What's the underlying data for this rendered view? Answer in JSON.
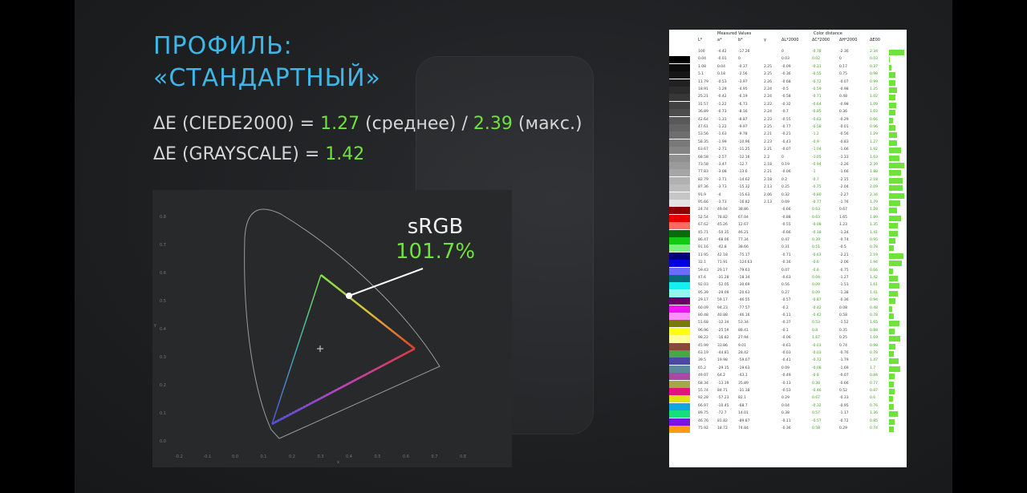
{
  "title": {
    "line1": "ПРОФИЛЬ:",
    "line2": "«СТАНДАРТНЫЙ»"
  },
  "metrics": {
    "m1_prefix": "ΔE (CIEDE2000) = ",
    "m1_avg": "1.27",
    "m1_avg_label": " (среднее) / ",
    "m1_max": "2.39",
    "m1_max_label": " (макс.)",
    "m2_prefix": "ΔE (GRAYSCALE) = ",
    "m2_value": "1.42"
  },
  "gamut": {
    "label": "sRGB",
    "percent": "101.7%",
    "accent": "#6fe33c"
  },
  "chart_axes": {
    "x_ticks": [
      "-0.2",
      "-0.1",
      "0.0",
      "0.1",
      "0.2",
      "0.3",
      "0.4",
      "0.5",
      "0.6",
      "0.7",
      "0.8"
    ],
    "y_ticks": [
      "0.0",
      "0.1",
      "0.2",
      "0.3",
      "0.4",
      "0.5",
      "0.6",
      "0.7",
      "0.8"
    ],
    "x_label": "x",
    "y_label": "y"
  },
  "table": {
    "header_measured": "Measured Values",
    "header_distance": "Color distance",
    "columns": [
      "L*",
      "a*",
      "b*",
      "γ",
      "ΔL*2000",
      "ΔC*2000",
      "ΔH*2000",
      "ΔE00"
    ],
    "rows": [
      {
        "color": "#ffffff",
        "L": "100",
        "a": "-4.42",
        "b": "-17.26",
        "g": "",
        "dL": "0",
        "dC": "-0.78",
        "dH": "-2.36",
        "dE": "2.34"
      },
      {
        "color": "#000000",
        "L": "0.04",
        "a": "-0.01",
        "b": "0",
        "g": "",
        "dL": "0.03",
        "dC": "0.02",
        "dH": "0",
        "dE": "0.03"
      },
      {
        "color": "#0c0c0c",
        "L": "1.08",
        "a": "0.04",
        "b": "-0.37",
        "g": "2.25",
        "dL": "-0.09",
        "dC": "-0.31",
        "dH": "0.17",
        "dE": "0.37"
      },
      {
        "color": "#161616",
        "L": "5.1",
        "a": "0.18",
        "b": "-2.56",
        "g": "2.25",
        "dL": "-0.36",
        "dC": "-0.55",
        "dH": "0.75",
        "dE": "0.98"
      },
      {
        "color": "#212121",
        "L": "11.79",
        "a": "-0.53",
        "b": "-3.97",
        "g": "2.26",
        "dL": "-0.68",
        "dC": "-0.72",
        "dH": "-0.07",
        "dE": "0.99"
      },
      {
        "color": "#2c2c2c",
        "L": "18.91",
        "a": "-1.29",
        "b": "-4.95",
        "g": "2.24",
        "dL": "-0.5",
        "dC": "-0.59",
        "dH": "-0.98",
        "dE": "1.25"
      },
      {
        "color": "#373737",
        "L": "25.21",
        "a": "-0.42",
        "b": "-6.19",
        "g": "2.24",
        "dL": "-0.58",
        "dC": "-0.71",
        "dH": "0.48",
        "dE": "1.02"
      },
      {
        "color": "#424242",
        "L": "31.57",
        "a": "-1.22",
        "b": "-6.73",
        "g": "2.22",
        "dL": "-0.32",
        "dC": "-0.64",
        "dH": "-0.98",
        "dE": "1.09"
      },
      {
        "color": "#4d4d4d",
        "L": "36.89",
        "a": "-0.73",
        "b": "-8.16",
        "g": "2.24",
        "dL": "-0.7",
        "dC": "-0.85",
        "dH": "0.36",
        "dE": "1.03"
      },
      {
        "color": "#585858",
        "L": "42.64",
        "a": "-1.31",
        "b": "-8.87",
        "g": "2.23",
        "dL": "-0.55",
        "dC": "-0.63",
        "dH": "-0.29",
        "dE": "0.66"
      },
      {
        "color": "#636363",
        "L": "47.61",
        "a": "-1.22",
        "b": "-9.97",
        "g": "2.25",
        "dL": "-0.77",
        "dC": "-0.58",
        "dH": "-0.01",
        "dE": "0.96"
      },
      {
        "color": "#6e6e6e",
        "L": "53.56",
        "a": "-1.63",
        "b": "-9.78",
        "g": "2.21",
        "dL": "-0.21",
        "dC": "-1.2",
        "dH": "-0.56",
        "dE": "1.29"
      },
      {
        "color": "#797979",
        "L": "58.35",
        "a": "-1.99",
        "b": "-10.96",
        "g": "2.23",
        "dL": "-0.43",
        "dC": "-0.9",
        "dH": "-0.83",
        "dE": "1.27"
      },
      {
        "color": "#848484",
        "L": "63.67",
        "a": "-2.71",
        "b": "-11.25",
        "g": "2.21",
        "dL": "-0.07",
        "dC": "-1.04",
        "dH": "-1.66",
        "dE": "1.92"
      },
      {
        "color": "#8f8f8f",
        "L": "68.58",
        "a": "-2.57",
        "b": "-12.16",
        "g": "2.2",
        "dL": "0",
        "dC": "-1.05",
        "dH": "-1.33",
        "dE": "1.63"
      },
      {
        "color": "#9a9a9a",
        "L": "73.58",
        "a": "-3.47",
        "b": "-12.7",
        "g": "2.18",
        "dL": "0.19",
        "dC": "-0.94",
        "dH": "-2.26",
        "dE": "2.39"
      },
      {
        "color": "#a5a5a5",
        "L": "77.83",
        "a": "-3.08",
        "b": "-13.6",
        "g": "2.21",
        "dL": "-0.06",
        "dC": "-1",
        "dH": "-1.66",
        "dE": "1.88"
      },
      {
        "color": "#b0b0b0",
        "L": "82.79",
        "a": "-3.71",
        "b": "-14.62",
        "g": "2.18",
        "dL": "0.2",
        "dC": "-0.7",
        "dH": "-2.15",
        "dE": "2.18"
      },
      {
        "color": "#bbbbbb",
        "L": "87.36",
        "a": "-3.73",
        "b": "-15.32",
        "g": "2.13",
        "dL": "0.25",
        "dC": "-0.75",
        "dH": "-2.04",
        "dE": "2.09"
      },
      {
        "color": "#c6c6c6",
        "L": "91.9",
        "a": "-4",
        "b": "-15.63",
        "g": "2.06",
        "dL": "0.32",
        "dC": "-0.80",
        "dH": "-2.27",
        "dE": "2.34"
      },
      {
        "color": "#e3e3e3",
        "L": "95.66",
        "a": "-3.73",
        "b": "-16.82",
        "g": "2.13",
        "dL": "0.09",
        "dC": "-0.77",
        "dH": "-1.76",
        "dE": "1.79"
      },
      {
        "color": "#8b0000",
        "L": "24.74",
        "a": "49.04",
        "b": "38.86",
        "g": "",
        "dL": "-0.66",
        "dC": "0.63",
        "dH": "0.67",
        "dE": "1.28"
      },
      {
        "color": "#e60000",
        "L": "52.54",
        "a": "78.82",
        "b": "67.04",
        "g": "",
        "dL": "-0.88",
        "dC": "0.63",
        "dH": "1.65",
        "dE": "1.89"
      },
      {
        "color": "#ff6a5e",
        "L": "67.62",
        "a": "45.26",
        "b": "12.67",
        "g": "",
        "dL": "-0.55",
        "dC": "-0.08",
        "dH": "1.23",
        "dE": "1.35"
      },
      {
        "color": "#0a6b0a",
        "L": "45.71",
        "a": "-50.35",
        "b": "46.21",
        "g": "",
        "dL": "-0.66",
        "dC": "-0.18",
        "dH": "-1.24",
        "dE": "1.41"
      },
      {
        "color": "#14c814",
        "L": "86.47",
        "a": "-68.06",
        "b": "77.34",
        "g": "",
        "dL": "0.47",
        "dC": "0.39",
        "dH": "-0.74",
        "dE": "0.95"
      },
      {
        "color": "#7cf07c",
        "L": "91.16",
        "a": "-42.8",
        "b": "38.66",
        "g": "",
        "dL": "0.31",
        "dC": "0.51",
        "dH": "-0.5",
        "dE": "0.78"
      },
      {
        "color": "#00007a",
        "L": "11.95",
        "a": "42.18",
        "b": "-75.17",
        "g": "",
        "dL": "-0.71",
        "dC": "-0.63",
        "dH": "-2.21",
        "dE": "2.19"
      },
      {
        "color": "#0000e0",
        "L": "32.1",
        "a": "71.91",
        "b": "-124.63",
        "g": "",
        "dL": "-0.16",
        "dC": "-0.6",
        "dH": "-2.06",
        "dE": "1.94"
      },
      {
        "color": "#6b6bff",
        "L": "59.43",
        "a": "29.17",
        "b": "-79.63",
        "g": "",
        "dL": "0.07",
        "dC": "-0.6",
        "dH": "-0.75",
        "dE": "0.66"
      },
      {
        "color": "#0a6b7a",
        "L": "47.6",
        "a": "-31.28",
        "b": "-18.34",
        "g": "",
        "dL": "-0.63",
        "dC": "0.04",
        "dH": "-1.27",
        "dE": "1.42"
      },
      {
        "color": "#14f0f0",
        "L": "92.03",
        "a": "-52.05",
        "b": "-30.69",
        "g": "",
        "dL": "0.56",
        "dC": "0.09",
        "dH": "-1.51",
        "dE": "1.61"
      },
      {
        "color": "#8ff5f5",
        "L": "95.39",
        "a": "-29.09",
        "b": "-20.63",
        "g": "",
        "dL": "0.27",
        "dC": "0.09",
        "dH": "-1.38",
        "dE": "1.41"
      },
      {
        "color": "#6b006b",
        "L": "29.17",
        "a": "59.17",
        "b": "-46.55",
        "g": "",
        "dL": "-0.57",
        "dC": "-0.87",
        "dH": "-0.36",
        "dE": "0.94"
      },
      {
        "color": "#f014f0",
        "L": "60.09",
        "a": "94.23",
        "b": "-77.57",
        "g": "",
        "dL": "-0.2",
        "dC": "-0.42",
        "dH": "0.08",
        "dE": "0.48"
      },
      {
        "color": "#ff8fff",
        "L": "80.48",
        "a": "40.88",
        "b": "-46.16",
        "g": "",
        "dL": "-0.11",
        "dC": "-0.42",
        "dH": "0.58",
        "dE": "0.78"
      },
      {
        "color": "#7a7a0a",
        "L": "51.68",
        "a": "-12.34",
        "b": "53.34",
        "g": "",
        "dL": "-0.37",
        "dC": "0.53",
        "dH": "-1.52",
        "dE": "1.65"
      },
      {
        "color": "#ffff14",
        "L": "96.96",
        "a": "-25.59",
        "b": "88.41",
        "g": "",
        "dL": "-0.1",
        "dC": "0.8",
        "dH": "0.35",
        "dE": "0.88"
      },
      {
        "color": "#ffff99",
        "L": "98.22",
        "a": "-16.82",
        "b": "27.94",
        "g": "",
        "dL": "-0.06",
        "dC": "1.67",
        "dH": "0.25",
        "dE": "1.69"
      },
      {
        "color": "#8a4a3a",
        "L": "45.99",
        "a": "33.86",
        "b": "9.01",
        "g": "",
        "dL": "-0.61",
        "dC": "-0.03",
        "dH": "0.74",
        "dE": "0.98"
      },
      {
        "color": "#4aa64a",
        "L": "63.19",
        "a": "-44.81",
        "b": "28.42",
        "g": "",
        "dL": "-0.03",
        "dC": "-0.03",
        "dH": "-0.76",
        "dE": "0.78"
      },
      {
        "color": "#4a4aa6",
        "L": "39.5",
        "a": "19.98",
        "b": "-59.07",
        "g": "",
        "dL": "-0.41",
        "dC": "-0.72",
        "dH": "-1.79",
        "dE": "1.47"
      },
      {
        "color": "#5a8a9a",
        "L": "65.2",
        "a": "-29.15",
        "b": "-19.63",
        "g": "",
        "dL": "0.09",
        "dC": "-0.08",
        "dH": "-1.69",
        "dE": "1.7"
      },
      {
        "color": "#a64aa6",
        "L": "49.07",
        "a": "64.2",
        "b": "-43.1",
        "g": "",
        "dL": "-0.49",
        "dC": "-0.8",
        "dH": "-0.07",
        "dE": "0.84"
      },
      {
        "color": "#a6a64a",
        "L": "68.34",
        "a": "-13.39",
        "b": "35.89",
        "g": "",
        "dL": "-0.13",
        "dC": "0.38",
        "dH": "-0.66",
        "dE": "0.77"
      },
      {
        "color": "#e0147a",
        "L": "55.74",
        "a": "84.71",
        "b": "-31.38",
        "g": "",
        "dL": "-0.53",
        "dC": "-0.46",
        "dH": "0.52",
        "dE": "0.87"
      },
      {
        "color": "#e0e014",
        "L": "92.28",
        "a": "-57.23",
        "b": "82.1",
        "g": "",
        "dL": "0.29",
        "dC": "0.67",
        "dH": "-0.33",
        "dE": "0.6"
      },
      {
        "color": "#14a6e0",
        "L": "66.97",
        "a": "-10.45",
        "b": "-68.7",
        "g": "",
        "dL": "0.04",
        "dC": "-0.32",
        "dH": "-0.95",
        "dE": "0.76"
      },
      {
        "color": "#14e07a",
        "L": "89.75",
        "a": "-72.7",
        "b": "14.01",
        "g": "",
        "dL": "0.38",
        "dC": "0.57",
        "dH": "-1.17",
        "dE": "1.36"
      },
      {
        "color": "#7a14e0",
        "L": "46.76",
        "a": "81.82",
        "b": "-89.87",
        "g": "",
        "dL": "-0.11",
        "dC": "-0.57",
        "dH": "-0.72",
        "dE": "0.85"
      },
      {
        "color": "#ff9a14",
        "L": "75.92",
        "a": "18.72",
        "b": "74.84",
        "g": "",
        "dL": "-0.36",
        "dC": "0.58",
        "dH": "0.29",
        "dE": "0.74"
      }
    ]
  }
}
